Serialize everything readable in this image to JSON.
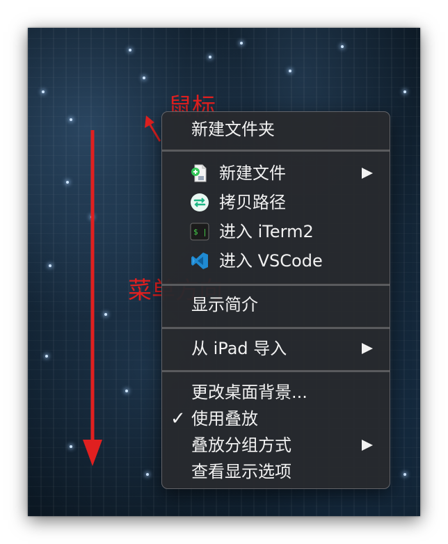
{
  "menu": {
    "items": [
      {
        "label": "新建文件夹"
      },
      {
        "label": "新建文件",
        "icon": "new-file-icon",
        "submenu": true
      },
      {
        "label": "拷贝路径",
        "icon": "copy-path-icon"
      },
      {
        "label": "进入 iTerm2",
        "icon": "iterm-icon"
      },
      {
        "label": "进入 VSCode",
        "icon": "vscode-icon"
      },
      {
        "label": "显示简介"
      },
      {
        "label": "从 iPad 导入",
        "submenu": true
      },
      {
        "label": "更改桌面背景..."
      },
      {
        "label": "使用叠放",
        "checked": true
      },
      {
        "label": "叠放分组方式",
        "submenu": true
      },
      {
        "label": "查看显示选项"
      }
    ]
  },
  "annotations": {
    "mouse_label": "鼠标",
    "direction_label": "菜单方向"
  },
  "colors": {
    "annotation": "#e02020",
    "menu_bg": "#282a2e",
    "menu_text": "#f2f2f2"
  }
}
